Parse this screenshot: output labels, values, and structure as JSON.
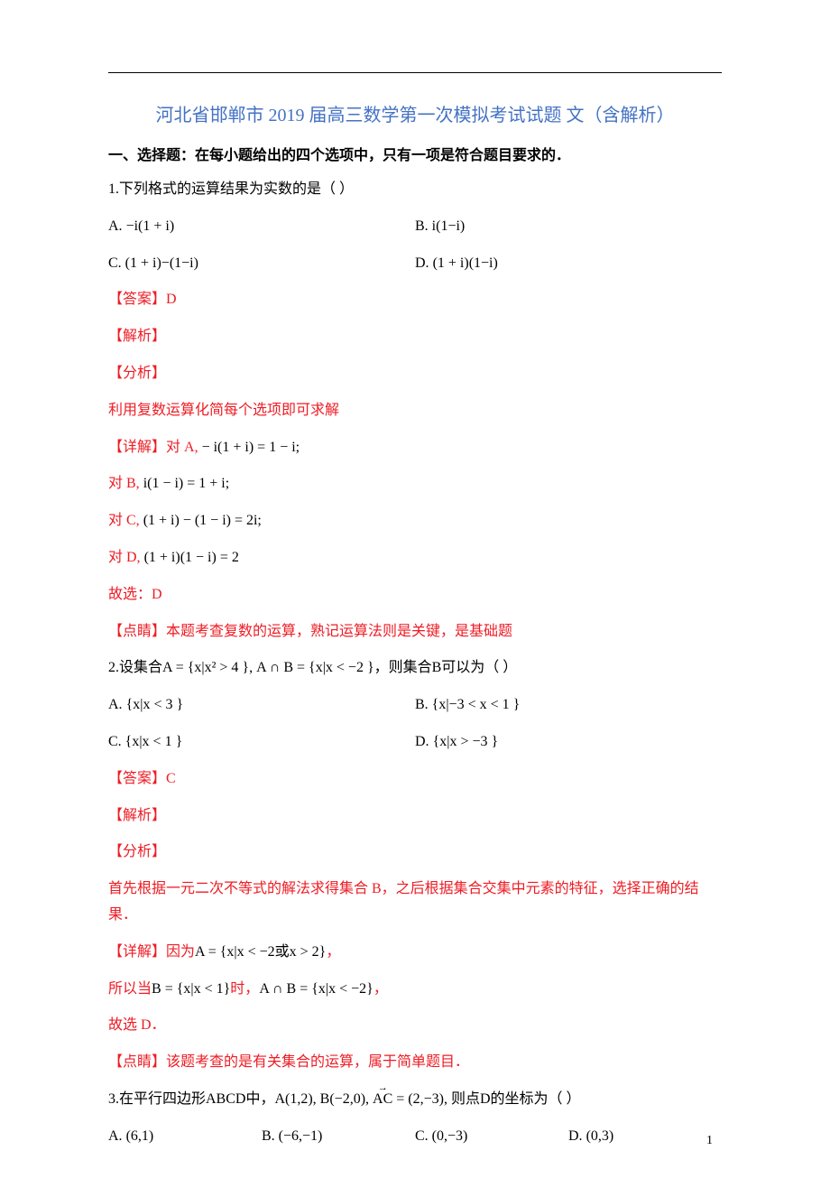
{
  "title": "河北省邯郸市 2019 届高三数学第一次模拟考试试题 文（含解析）",
  "sectionHeading": "一、选择题：在每小题给出的四个选项中，只有一项是符合题目要求的．",
  "q1": {
    "stem": "1.下列格式的运算结果为实数的是（  ）",
    "optA_label": "A.  ",
    "optA_math": "−i(1 + i)",
    "optB_label": "B.  ",
    "optB_math": "i(1−i)",
    "optC_label": "C.  ",
    "optC_math": "(1 + i)−(1−i)",
    "optD_label": "D.  ",
    "optD_math": "(1 + i)(1−i)",
    "answer_label": "【答案】",
    "answer_val": "D",
    "jiexi": "【解析】",
    "fenxi": "【分析】",
    "fenxi_text": "利用复数运算化简每个选项即可求解",
    "xiangjie_label": "【详解】",
    "xiangjie_A_pre": "对 A, ",
    "xiangjie_A_math": "− i(1 + i) = 1 − i;",
    "xiangjie_B_pre": "对 B, ",
    "xiangjie_B_math": "i(1 − i) = 1 + i;",
    "xiangjie_C_pre": "对 C,  ",
    "xiangjie_C_math": "(1 + i) − (1 − i) = 2i;",
    "xiangjie_D_pre": "对 D, ",
    "xiangjie_D_math": "(1 + i)(1 − i) = 2",
    "guxuan": "故选：D",
    "dianjing_label": "【点睛】",
    "dianjing_text": "本题考查复数的运算，熟记运算法则是关键，是基础题"
  },
  "q2": {
    "stem_pre": "2.设集合",
    "stem_mathA": "A = {x|x² > 4  }",
    "stem_mid1": ", ",
    "stem_mathAB": "A ∩ B = {x|x < −2  }",
    "stem_post": "，则集合B可以为（  ）",
    "optA_label": "A.  ",
    "optA_math": "{x|x < 3  }",
    "optB_label": "B.  ",
    "optB_math": "{x|−3 < x < 1  }",
    "optC_label": "C.  ",
    "optC_math": "{x|x < 1  }",
    "optD_label": "D.  ",
    "optD_math": "{x|x > −3  }",
    "answer_label": "【答案】",
    "answer_val": "C",
    "jiexi": "【解析】",
    "fenxi": "【分析】",
    "fenxi_text": "首先根据一元二次不等式的解法求得集合 B，之后根据集合交集中元素的特征，选择正确的结果．",
    "xiangjie_label": "【详解】",
    "xiangjie_pre1": "因为",
    "xiangjie_math1": "A = {x|x < −2或x > 2}",
    "xiangjie_post1": "，",
    "xiangjie_line2_pre": "所以当",
    "xiangjie_line2_mathB": "B = {x|x < 1}",
    "xiangjie_line2_mid": "时，",
    "xiangjie_line2_mathAB": "A ∩ B = {x|x < −2}",
    "xiangjie_line2_post": "，",
    "guxuan": "故选 D．",
    "dianjing_label": "【点睛】",
    "dianjing_text": "该题考查的是有关集合的运算，属于简单题目．"
  },
  "q3": {
    "stem_pre": "3.在平行四边形ABCD中，",
    "stem_mathA": "A(1,2), B(−2,0), ",
    "stem_vec": "AC",
    "stem_mathEq": " = (2,−3), ",
    "stem_post": "则点D的坐标为（  ）",
    "optA_label": "A.  ",
    "optA_math": "(6,1)",
    "optB_label": "B.  ",
    "optB_math": "(−6,−1)",
    "optC_label": "C.  ",
    "optC_math": "(0,−3)",
    "optD_label": "D.  ",
    "optD_math": "(0,3)"
  },
  "pageNum": "1"
}
